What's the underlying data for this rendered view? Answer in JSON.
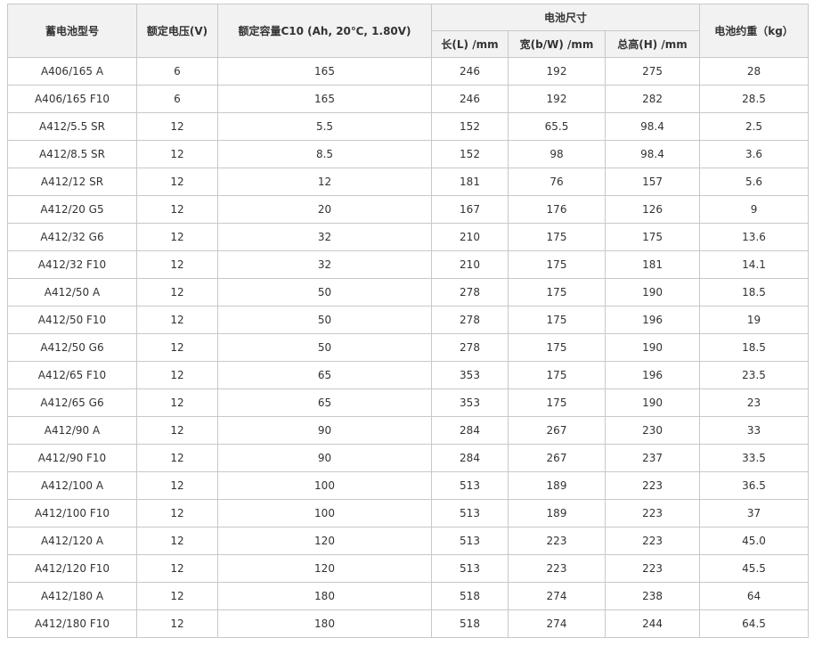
{
  "table": {
    "headers": {
      "model": "蓄电池型号",
      "voltage": "额定电压(V)",
      "capacity": "额定容量C10 (Ah, 20℃, 1.80V)",
      "dimensions": "电池尺寸",
      "length": "长(L) /mm",
      "width": "宽(b/W) /mm",
      "height": "总高(H) /mm",
      "weight": "电池约重（kg）"
    },
    "rows": [
      [
        "A406/165 A",
        "6",
        "165",
        "246",
        "192",
        "275",
        "28"
      ],
      [
        "A406/165 F10",
        "6",
        "165",
        "246",
        "192",
        "282",
        "28.5"
      ],
      [
        "A412/5.5 SR",
        "12",
        "5.5",
        "152",
        "65.5",
        "98.4",
        "2.5"
      ],
      [
        "A412/8.5 SR",
        "12",
        "8.5",
        "152",
        "98",
        "98.4",
        "3.6"
      ],
      [
        "A412/12 SR",
        "12",
        "12",
        "181",
        "76",
        "157",
        "5.6"
      ],
      [
        "A412/20 G5",
        "12",
        "20",
        "167",
        "176",
        "126",
        "9"
      ],
      [
        "A412/32 G6",
        "12",
        "32",
        "210",
        "175",
        "175",
        "13.6"
      ],
      [
        "A412/32 F10",
        "12",
        "32",
        "210",
        "175",
        "181",
        "14.1"
      ],
      [
        "A412/50 A",
        "12",
        "50",
        "278",
        "175",
        "190",
        "18.5"
      ],
      [
        "A412/50 F10",
        "12",
        "50",
        "278",
        "175",
        "196",
        "19"
      ],
      [
        "A412/50 G6",
        "12",
        "50",
        "278",
        "175",
        "190",
        "18.5"
      ],
      [
        "A412/65 F10",
        "12",
        "65",
        "353",
        "175",
        "196",
        "23.5"
      ],
      [
        "A412/65 G6",
        "12",
        "65",
        "353",
        "175",
        "190",
        "23"
      ],
      [
        "A412/90 A",
        "12",
        "90",
        "284",
        "267",
        "230",
        "33"
      ],
      [
        "A412/90 F10",
        "12",
        "90",
        "284",
        "267",
        "237",
        "33.5"
      ],
      [
        "A412/100 A",
        "12",
        "100",
        "513",
        "189",
        "223",
        "36.5"
      ],
      [
        "A412/100 F10",
        "12",
        "100",
        "513",
        "189",
        "223",
        "37"
      ],
      [
        "A412/120 A",
        "12",
        "120",
        "513",
        "223",
        "223",
        "45.0"
      ],
      [
        "A412/120 F10",
        "12",
        "120",
        "513",
        "223",
        "223",
        "45.5"
      ],
      [
        "A412/180 A",
        "12",
        "180",
        "518",
        "274",
        "238",
        "64"
      ],
      [
        "A412/180 F10",
        "12",
        "180",
        "518",
        "274",
        "244",
        "64.5"
      ]
    ]
  }
}
